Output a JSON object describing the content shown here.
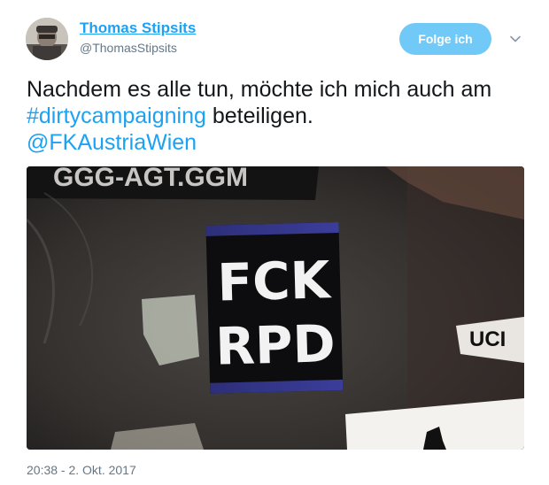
{
  "author": {
    "name": "Thomas Stipsits",
    "handle": "@ThomasStipsits"
  },
  "follow_button": {
    "label": "Folge ich"
  },
  "tweet": {
    "text_before": "Nachdem es alle tun, möchte ich mich auch am ",
    "hashtag": "#dirtycampaigning",
    "text_after": " beteiligen.",
    "mention": "@FKAustriaWien"
  },
  "media": {
    "sticker_text_line1": "FCK",
    "sticker_text_line2": "RPD",
    "top_sticker_text": "GGG-AGT.GGM",
    "right_sticker_text": "UCI"
  },
  "timestamp": "20:38 - 2. Okt. 2017",
  "colors": {
    "accent": "#1da1f2",
    "follow_button_bg": "#71c9f8",
    "secondary_text": "#657786"
  }
}
